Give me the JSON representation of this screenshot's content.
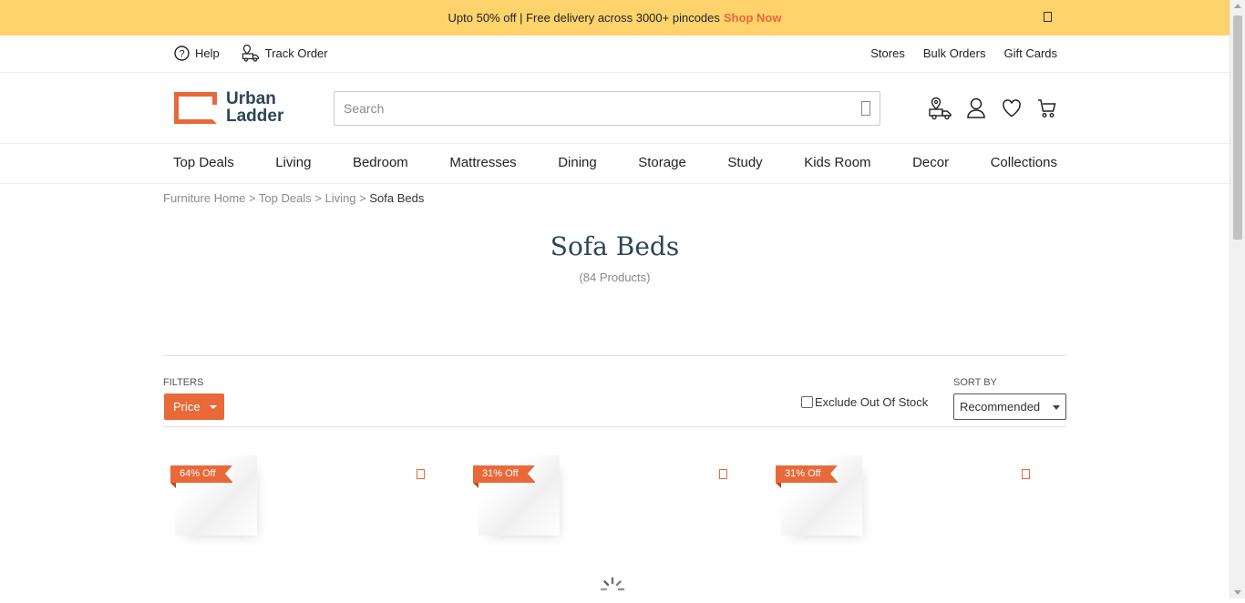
{
  "promo": {
    "text": "Upto 50% off | Free delivery across 3000+ pincodes",
    "cta": "Shop Now"
  },
  "util_bar": {
    "help": "Help",
    "track_order": "Track Order",
    "links": [
      "Stores",
      "Bulk Orders",
      "Gift Cards"
    ]
  },
  "logo": {
    "line1": "Urban",
    "line2": "Ladder"
  },
  "search": {
    "placeholder": "Search"
  },
  "nav": {
    "items": [
      "Top Deals",
      "Living",
      "Bedroom",
      "Mattresses",
      "Dining",
      "Storage",
      "Study",
      "Kids Room",
      "Decor",
      "Collections"
    ]
  },
  "breadcrumb": {
    "items": [
      "Furniture Home",
      "Top Deals",
      "Living"
    ],
    "current": "Sofa Beds"
  },
  "page": {
    "title": "Sofa Beds",
    "count": "(84 Products)"
  },
  "filters": {
    "label": "FILTERS",
    "price": "Price",
    "exclude_oos": "Exclude Out Of Stock"
  },
  "sort": {
    "label": "SORT BY",
    "selected": "Recommended"
  },
  "products": [
    {
      "discount": "64% Off"
    },
    {
      "discount": "31% Off"
    },
    {
      "discount": "31% Off"
    }
  ],
  "colors": {
    "accent": "#e8693a",
    "promo_bg": "#ffd36c",
    "brand_text": "#2c4557"
  }
}
